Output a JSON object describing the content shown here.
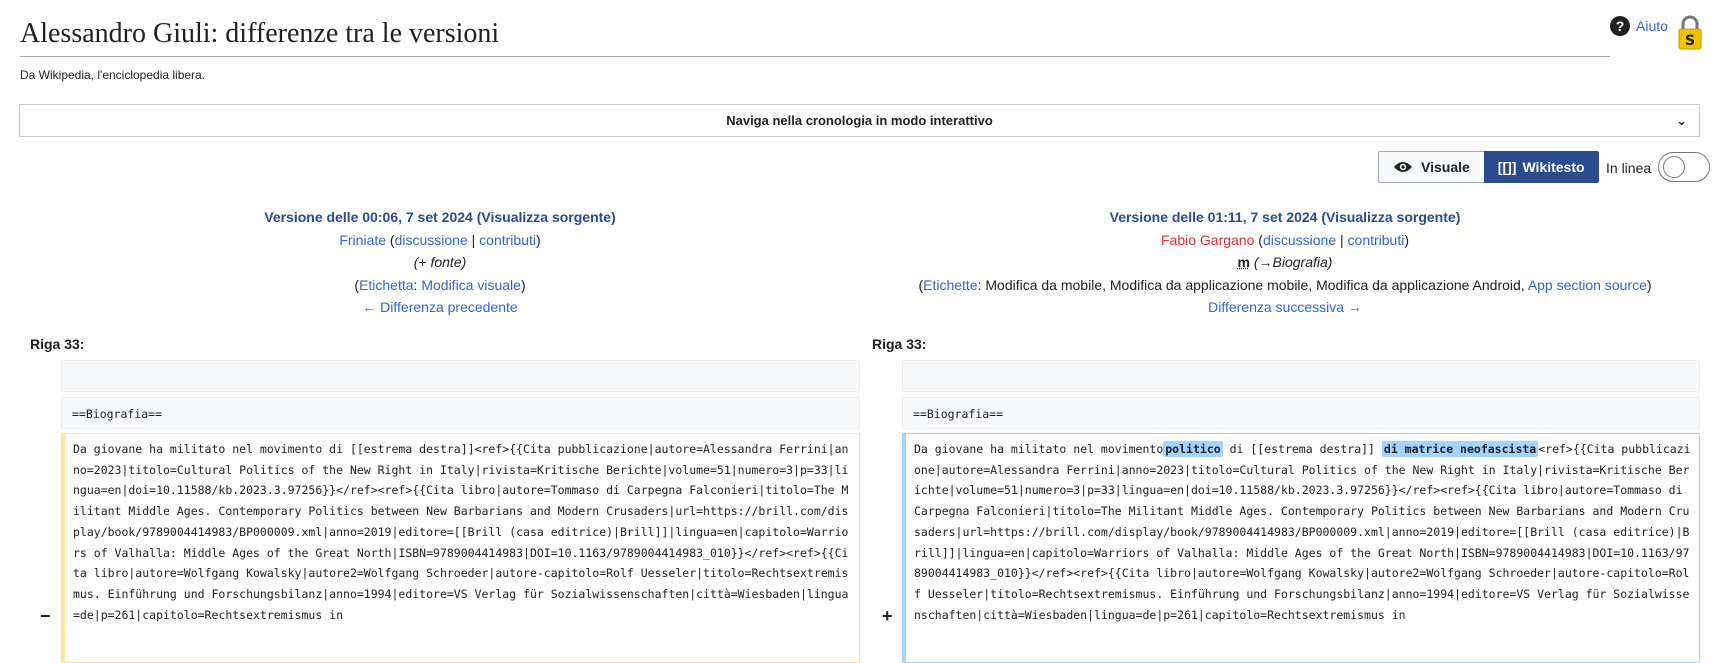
{
  "page": {
    "title": "Alessandro Giuli: differenze tra le versioni",
    "tagline": "Da Wikipedia, l'enciclopedia libera.",
    "help_label": "Aiuto"
  },
  "history_bar": {
    "label": "Naviga nella cronologia in modo interattivo"
  },
  "view_toggle": {
    "visual_label": "Visuale",
    "wikitext_icon": "[[]]",
    "wikitext_label": "Wikitesto",
    "inline_label": "In linea"
  },
  "left_version": {
    "title": "Versione delle 00:06, 7 set 2024",
    "source_link": "Visualizza sorgente",
    "user": "Friniate",
    "talk": "discussione",
    "contribs": "contributi",
    "comment": "(+ fonte)",
    "tag_label": "Etichetta",
    "tags": "Modifica visuale",
    "nav": "← Differenza precedente"
  },
  "right_version": {
    "title": "Versione delle 01:11, 7 set 2024",
    "source_link": "Visualizza sorgente",
    "user": "Fabio Gargano",
    "talk": "discussione",
    "contribs": "contributi",
    "minor": "m",
    "comment": "(→Biografia)",
    "tag_label": "Etichette",
    "tags": "Modifica da mobile, Modifica da applicazione mobile, Modifica da applicazione Android, ",
    "tag_link": "App section source",
    "nav": "Differenza successiva →"
  },
  "diff": {
    "line_left": "Riga 33:",
    "line_right": "Riga 33:",
    "context_line": "==Biografia==",
    "minus": "−",
    "plus": "+",
    "removed_text": "Da giovane ha militato nel movimento di [[estrema destra]]<ref>{{Cita pubblicazione|autore=Alessandra Ferrini|anno=2023|titolo=Cultural Politics of the New Right in Italy|rivista=Kritische Berichte|volume=51|numero=3|p=33|lingua=en|doi=10.11588/kb.2023.3.97256}}</ref><ref>{{Cita libro|autore=Tommaso di Carpegna Falconieri|titolo=The Militant Middle Ages. Contemporary Politics between New Barbarians and Modern Crusaders|url=https://brill.com/display/book/9789004414983/BP000009.xml|anno=2019|editore=[[Brill (casa editrice)|Brill]]|lingua=en|capitolo=Warriors of Valhalla: Middle Ages of the Great North|ISBN=9789004414983|DOI=10.1163/9789004414983_010}}</ref><ref>{{Cita libro|autore=Wolfgang Kowalsky|autore2=Wolfgang Schroeder|autore-capitolo=Rolf Uesseler|titolo=Rechtsextremismus. Einführung und Forschungsbilanz|anno=1994|editore=VS Verlag für Sozialwissenschaften|città=Wiesbaden|lingua=de|p=261|capitolo=Rechtsextremismus in",
    "added_pre": "Da giovane ha militato nel movimento",
    "added_hl1": "politico",
    "added_mid": " di [[estrema destra]] ",
    "added_hl2": "di matrice neofascista",
    "added_post": "<ref>{{Cita pubblicazione|autore=Alessandra Ferrini|anno=2023|titolo=Cultural Politics of the New Right in Italy|rivista=Kritische Berichte|volume=51|numero=3|p=33|lingua=en|doi=10.11588/kb.2023.3.97256}}</ref><ref>{{Cita libro|autore=Tommaso di Carpegna Falconieri|titolo=The Militant Middle Ages. Contemporary Politics between New Barbarians and Modern Crusaders|url=https://brill.com/display/book/9789004414983/BP000009.xml|anno=2019|editore=[[Brill (casa editrice)|Brill]]|lingua=en|capitolo=Warriors of Valhalla: Middle Ages of the Great North|ISBN=9789004414983|DOI=10.1163/9789004414983_010}}</ref><ref>{{Cita libro|autore=Wolfgang Kowalsky|autore2=Wolfgang Schroeder|autore-capitolo=Rolf Uesseler|titolo=Rechtsextremismus. Einführung und Forschungsbilanz|anno=1994|editore=VS Verlag für Sozialwissenschaften|città=Wiesbaden|lingua=de|p=261|capitolo=Rechtsextremismus in"
  },
  "colors": {
    "link": "#3366cc",
    "redlink": "#d73333",
    "removed_border": "#ffe49c",
    "added_border": "#a3d3ff",
    "active_button": "#2a4b8d"
  }
}
